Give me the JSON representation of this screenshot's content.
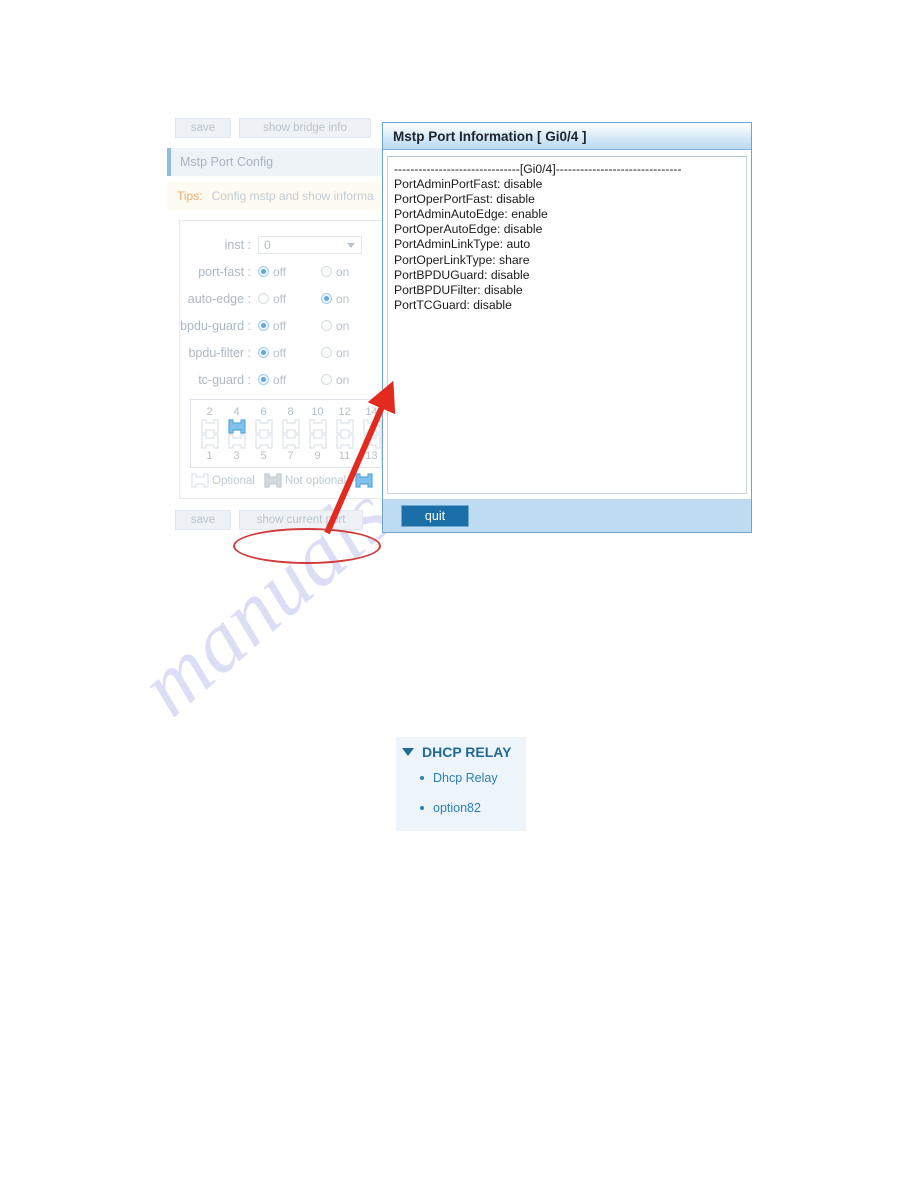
{
  "watermark": {
    "text": "manualshive.com"
  },
  "config_panel": {
    "top_buttons": [
      {
        "label": "save",
        "name": "save-button-top"
      },
      {
        "label": "show bridge info",
        "name": "show-bridge-info-button"
      }
    ],
    "panel_title": "Mstp Port Config",
    "tips_label": "Tips:",
    "tips_text": "Config mstp and show informa",
    "form": {
      "inst": {
        "label": "inst :",
        "value": "0"
      },
      "rows": [
        {
          "label": "port-fast :",
          "off_label": "off",
          "on_label": "on",
          "selected": "off"
        },
        {
          "label": "auto-edge :",
          "off_label": "off",
          "on_label": "on",
          "selected": "on"
        },
        {
          "label": "bpdu-guard :",
          "off_label": "off",
          "on_label": "on",
          "selected": "off"
        },
        {
          "label": "bpdu-filter :",
          "off_label": "off",
          "on_label": "on",
          "selected": "off"
        },
        {
          "label": "tc-guard :",
          "off_label": "off",
          "on_label": "on",
          "selected": "off"
        }
      ]
    },
    "port_grid": {
      "top_numbers": [
        "2",
        "4",
        "6",
        "8",
        "10",
        "12",
        "14"
      ],
      "bottom_numbers": [
        "1",
        "3",
        "5",
        "7",
        "9",
        "11",
        "13"
      ],
      "selected_port": "4",
      "selected_color": "#7fc1ea"
    },
    "legend": [
      {
        "label": "Optional",
        "state": "optional"
      },
      {
        "label": "Not optional",
        "state": "not-optional"
      },
      {
        "label": "",
        "state": "selected"
      }
    ],
    "bottom_buttons": [
      {
        "label": "save",
        "name": "save-button-bottom"
      },
      {
        "label": "show current port",
        "name": "show-current-port-button"
      }
    ]
  },
  "dialog": {
    "title": "Mstp Port Information [ Gi0/4 ]",
    "lines": [
      "-------------------------------[Gi0/4]-------------------------------",
      "PortAdminPortFast: disable",
      "PortOperPortFast: disable",
      "PortAdminAutoEdge: enable",
      "PortOperAutoEdge: disable",
      "PortAdminLinkType: auto",
      "PortOperLinkType: share",
      "PortBPDUGuard: disable",
      "PortBPDUFilter: disable",
      "PortTCGuard: disable"
    ],
    "quit_label": "quit"
  },
  "dhcp_menu": {
    "header": "DHCP RELAY",
    "items": [
      {
        "label": "Dhcp Relay"
      },
      {
        "label": "option82"
      }
    ]
  },
  "colors": {
    "accent_blue": "#1b6fa8",
    "dialog_border": "#6ca6d0",
    "footer_bg": "#bddcf2",
    "annotation_red": "#d23b3b",
    "tips_orange": "#f2ac6a",
    "watermark": "#c9cbf0"
  }
}
